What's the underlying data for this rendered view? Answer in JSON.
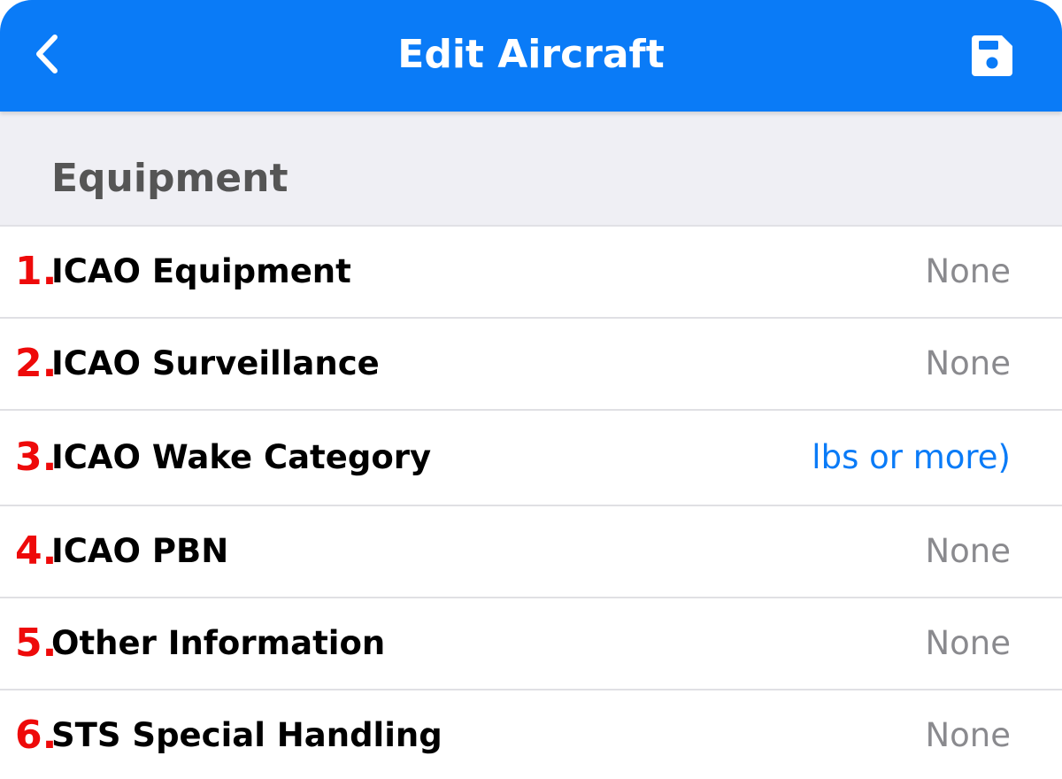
{
  "header": {
    "title": "Edit Aircraft",
    "back_icon": "chevron-left-icon",
    "save_icon": "floppy-disk-icon"
  },
  "section": {
    "title": "Equipment"
  },
  "rows": [
    {
      "number": "1.",
      "label": "ICAO Equipment",
      "value": "None"
    },
    {
      "number": "2.",
      "label": "ICAO Surveillance",
      "value": "None"
    },
    {
      "number": "3.",
      "label": "ICAO Wake Category",
      "value": "lbs or more)"
    },
    {
      "number": "4.",
      "label": "ICAO PBN",
      "value": "None"
    },
    {
      "number": "5.",
      "label": "Other Information",
      "value": "None"
    },
    {
      "number": "6.",
      "label": "STS Special Handling",
      "value": "None"
    }
  ],
  "colors": {
    "accent": "#0a7bf7",
    "number": "#ee0a0a",
    "value": "#8a8a8e",
    "section_bg": "#efeff4"
  }
}
